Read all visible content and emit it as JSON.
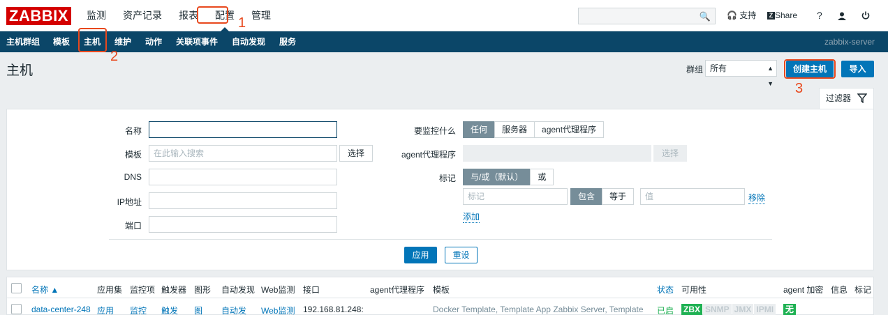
{
  "logo": "ZABBIX",
  "main_menu": [
    {
      "label": "监测"
    },
    {
      "label": "资产记录"
    },
    {
      "label": "报表"
    },
    {
      "label": "配置"
    },
    {
      "label": "管理"
    }
  ],
  "annotations": {
    "one": "1",
    "two": "2",
    "three": "3"
  },
  "search": {
    "placeholder": ""
  },
  "top_right": {
    "support": "支持",
    "share": "Share",
    "help": "?",
    "user": "user-icon",
    "logout": "power-icon"
  },
  "sub_menu": [
    {
      "label": "主机群组"
    },
    {
      "label": "模板"
    },
    {
      "label": "主机"
    },
    {
      "label": "维护"
    },
    {
      "label": "动作"
    },
    {
      "label": "关联项事件"
    },
    {
      "label": "自动发现"
    },
    {
      "label": "服务"
    }
  ],
  "server_name": "zabbix-server",
  "page": {
    "title": "主机",
    "group_label": "群组",
    "group_value": "所有",
    "create_button": "创建主机",
    "import_button": "导入",
    "filter_tab": "过滤器"
  },
  "filter": {
    "name_label": "名称",
    "template_label": "模板",
    "template_placeholder": "在此输入搜索",
    "select_button": "选择",
    "dns_label": "DNS",
    "ip_label": "IP地址",
    "port_label": "端口",
    "monitor_label": "要监控什么",
    "monitor_options": [
      "任何",
      "服务器",
      "agent代理程序"
    ],
    "proxy_label": "agent代理程序",
    "proxy_select_button": "选择",
    "tags_label": "标记",
    "tag_mode_options": [
      "与/或（默认）",
      "或"
    ],
    "tag_placeholder": "标记",
    "tag_ops": [
      "包含",
      "等于"
    ],
    "value_placeholder": "值",
    "remove_link": "移除",
    "add_link": "添加",
    "apply_button": "应用",
    "reset_button": "重设"
  },
  "table": {
    "headers": {
      "name": "名称 ▲",
      "applications": "应用集",
      "items": "监控项",
      "triggers": "触发器",
      "graphs": "图形",
      "discovery": "自动发现",
      "web": "Web监测",
      "interface": "接口",
      "proxy": "agent代理程序",
      "templates": "模板",
      "status": "状态",
      "availability": "可用性",
      "encryption": "agent 加密",
      "info": "信息",
      "tags": "标记"
    },
    "rows": [
      {
        "name": "data-center-248",
        "applications": "应用",
        "items": "监控",
        "triggers": "触发",
        "graphs": "图",
        "discovery": "自动发",
        "web": "Web监测",
        "interface": "192.168.81.248:",
        "templates": "Docker Template, Template App Zabbix Server, Template",
        "status": "已启",
        "zbx": "ZBX",
        "snmp": "SNMP",
        "jmx": "JMX",
        "ipmi": "IPMI",
        "encryption": "无"
      }
    ]
  },
  "colors": {
    "brand": "#d40000",
    "nav": "#0b4668",
    "link": "#0275b8",
    "annotation": "#e8481d",
    "green": "#1fb153"
  }
}
